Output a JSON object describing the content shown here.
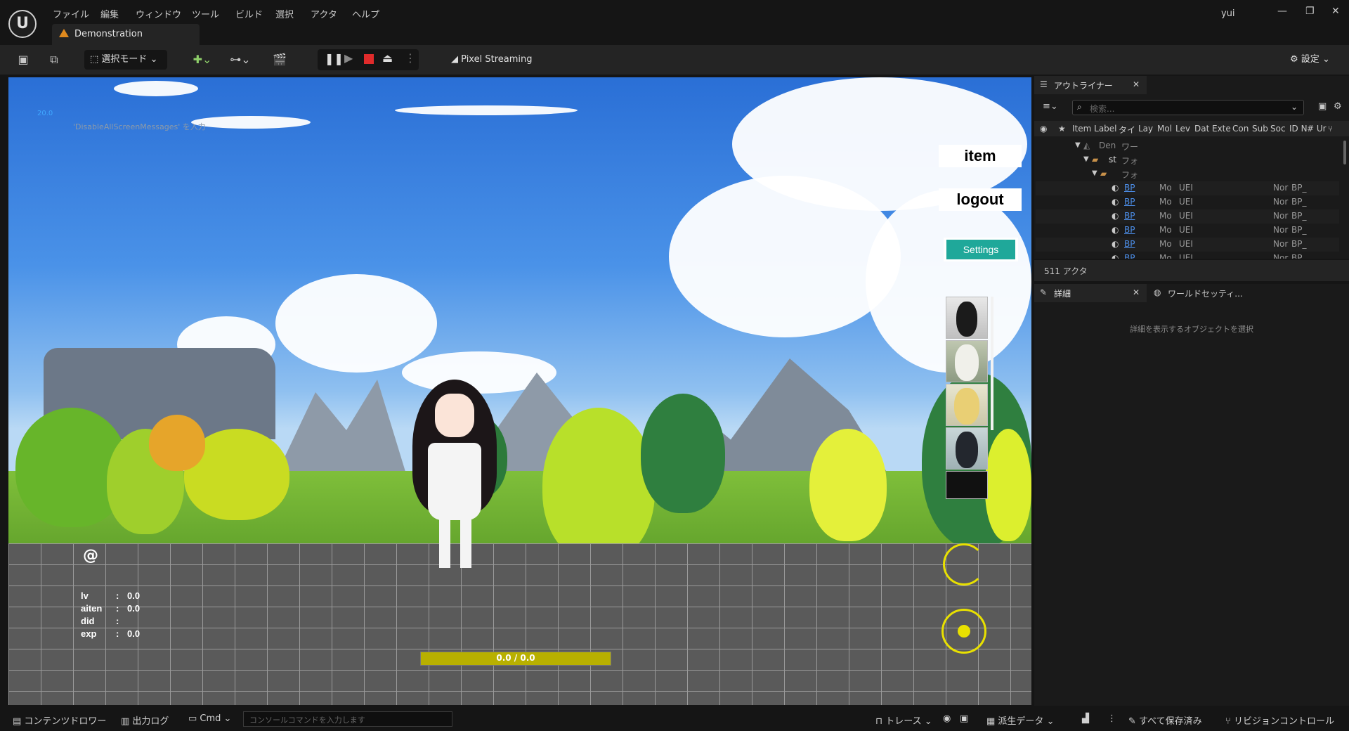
{
  "menu": {
    "items": [
      "ファイル",
      "編集",
      "ウィンドウ",
      "ツール",
      "ビルド",
      "選択",
      "アクタ",
      "ヘルプ"
    ]
  },
  "user": "yui",
  "document_tab": "Demonstration",
  "toolbar": {
    "mode_label": "選択モード",
    "pixel_streaming_label": "Pixel Streaming",
    "settings_label": "設定"
  },
  "viewport": {
    "fps": "20.0",
    "screen_message": "'DisableAllScreenMessages' を入力",
    "at_symbol": "@",
    "stats": [
      {
        "label": "lv",
        "value": "0.0"
      },
      {
        "label": "aiten",
        "value": "0.0"
      },
      {
        "label": "did",
        "value": ""
      },
      {
        "label": "exp",
        "value": "0.0"
      }
    ],
    "stat_separator": ":",
    "hp_text": "0.0 / 0.0",
    "hp_fill": 1.0,
    "buttons": {
      "item": "item",
      "logout": "logout",
      "settings": "Settings"
    }
  },
  "outliner": {
    "tab_title": "アウトライナー",
    "search_placeholder": "検索...",
    "columns": [
      "Item Label",
      "タイ",
      "Lay",
      "Mol",
      "Lev",
      "Dat",
      "Exte",
      "Con",
      "Sub",
      "Soc",
      "ID N",
      "# Ur"
    ],
    "tree_rows": [
      {
        "label": "Den",
        "type": "ワー"
      },
      {
        "label": "st",
        "type": "フォ"
      },
      {
        "label": "",
        "type": "フォ"
      }
    ],
    "actor_rows": [
      {
        "label": "BP",
        "c1": "Mo",
        "c2": "UEI",
        "c3": "Nor",
        "c4": "BP_"
      },
      {
        "label": "BP",
        "c1": "Mo",
        "c2": "UEI",
        "c3": "Nor",
        "c4": "BP_"
      },
      {
        "label": "BP",
        "c1": "Mo",
        "c2": "UEI",
        "c3": "Nor",
        "c4": "BP_"
      },
      {
        "label": "BP",
        "c1": "Mo",
        "c2": "UEI",
        "c3": "Nor",
        "c4": "BP_"
      },
      {
        "label": "BP",
        "c1": "Mo",
        "c2": "UEI",
        "c3": "Nor",
        "c4": "BP_"
      },
      {
        "label": "BP",
        "c1": "Mo",
        "c2": "UEI",
        "c3": "Nor",
        "c4": "BP_"
      }
    ],
    "actor_count": "511 アクタ"
  },
  "details": {
    "tab_title": "詳細",
    "world_settings_tab": "ワールドセッティ...",
    "empty_message": "詳細を表示するオブジェクトを選択"
  },
  "bottombar": {
    "content_drawer": "コンテンツドロワー",
    "output_log": "出力ログ",
    "cmd": "Cmd",
    "console_placeholder": "コンソールコマンドを入力します",
    "trace": "トレース",
    "derived_data": "派生データ",
    "save_all": "すべて保存済み",
    "revision_control": "リビジョンコントロール"
  }
}
